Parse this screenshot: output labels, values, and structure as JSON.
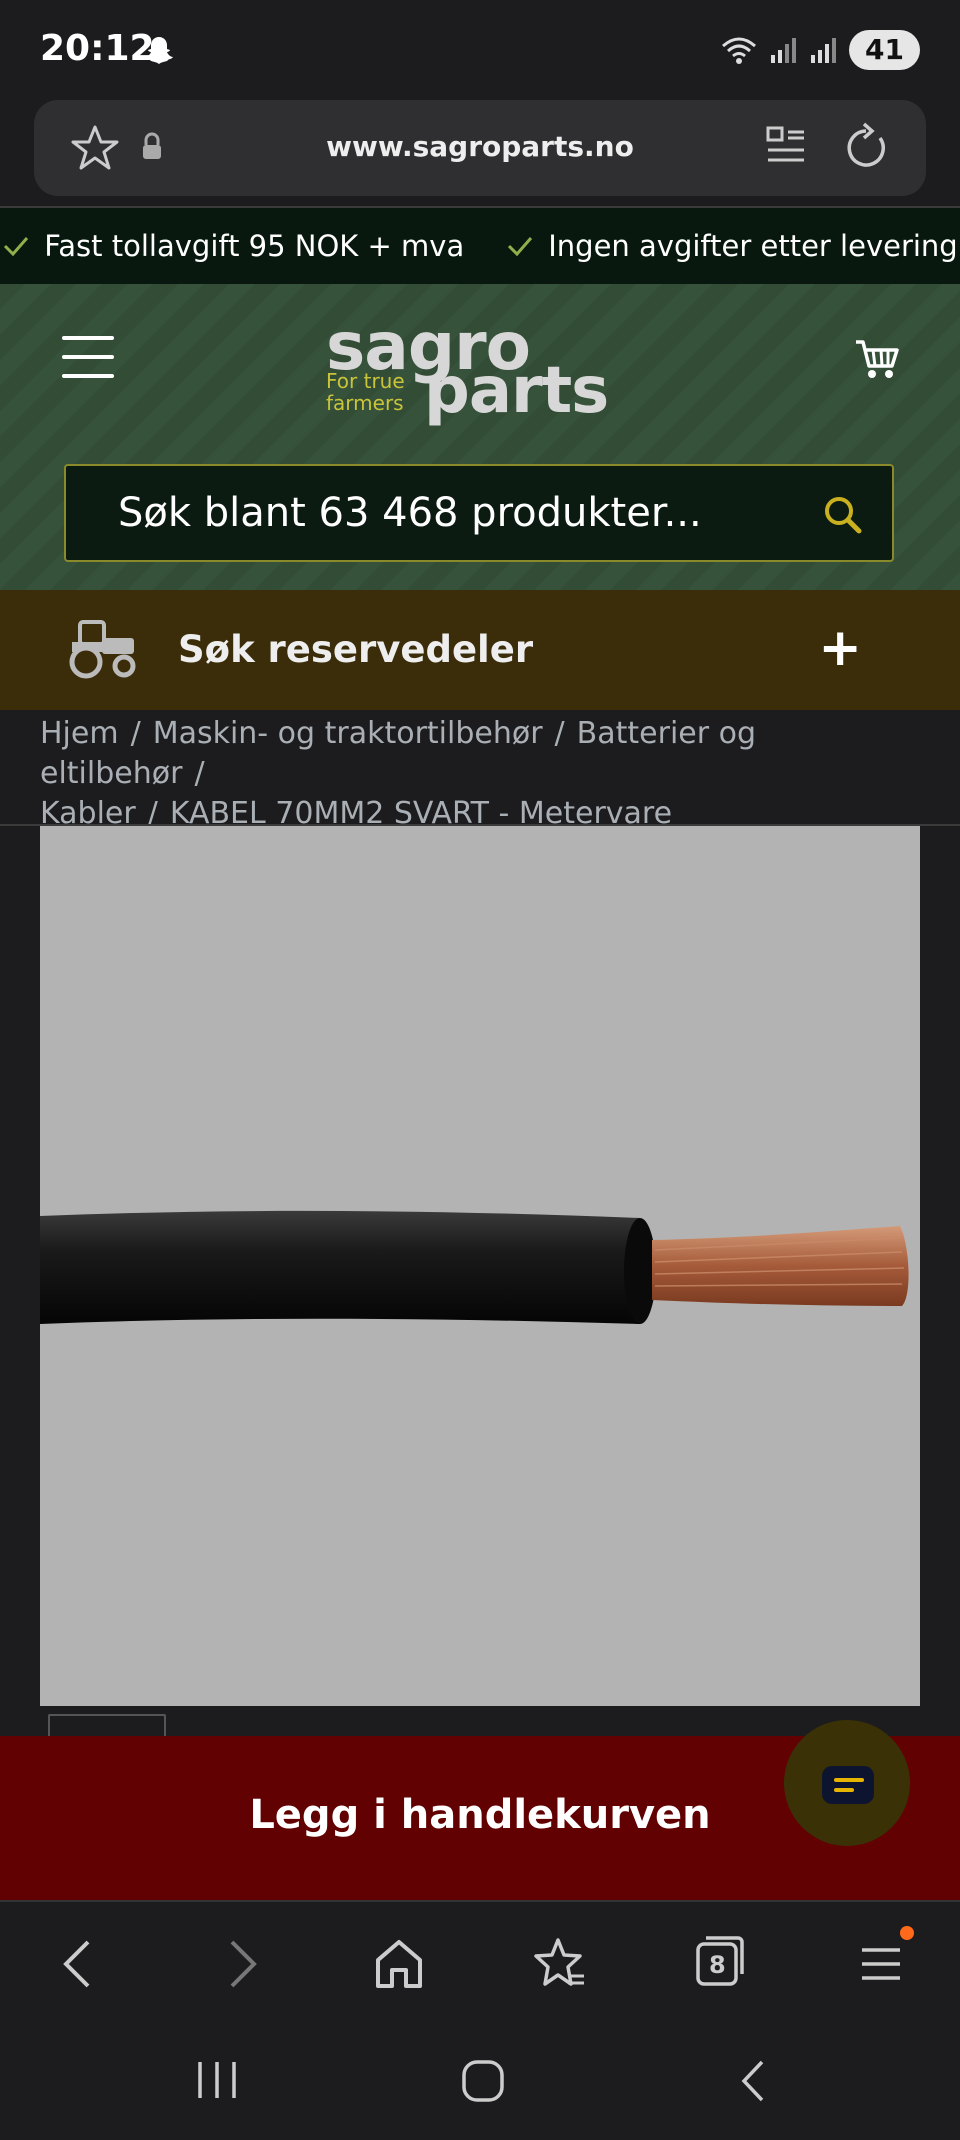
{
  "status_bar": {
    "time": "20:12",
    "battery": "41"
  },
  "browser": {
    "url": "www.sagroparts.no",
    "tab_count": "8"
  },
  "usp": [
    {
      "label": "Fast tollavgift 95 NOK + mva"
    },
    {
      "label": "Ingen avgifter etter levering"
    }
  ],
  "header": {
    "logo_word1": "sagro",
    "logo_word2": "parts",
    "logo_tagline": "For true farmers",
    "search_placeholder": "Søk blant 63 468 produkter..."
  },
  "parts_search": {
    "label": "Søk reservedeler",
    "toggle": "+"
  },
  "breadcrumb": [
    {
      "label": "Hjem"
    },
    {
      "label": "Maskin- og traktortilbehør"
    },
    {
      "label": "Batterier og eltilbehør"
    },
    {
      "label": "Kabler"
    },
    {
      "label": "KABEL 70MM2 SVART - Metervare"
    }
  ],
  "product": {
    "cta_label": "Legg i handlekurven"
  },
  "colors": {
    "usp_bar": "#08180e",
    "header_green": "#36523b",
    "parts_bar": "#3b2d0a",
    "cta_red": "#620101",
    "accent_yellow": "#c9c43a"
  }
}
